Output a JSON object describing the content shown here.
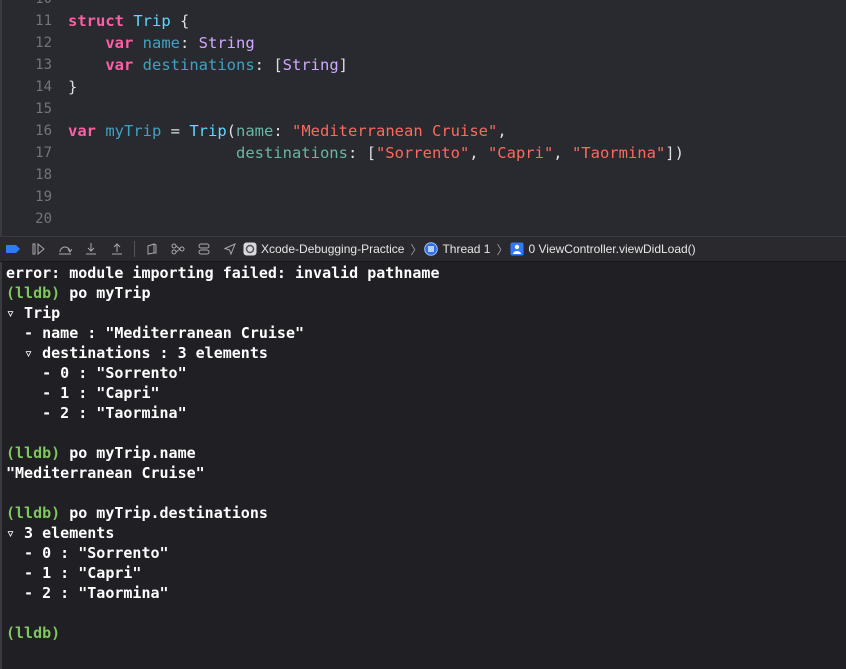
{
  "editor": {
    "lines": [
      {
        "num": "10",
        "tokens": []
      },
      {
        "num": "11",
        "tokens": [
          {
            "t": "struct",
            "c": "kw"
          },
          {
            "t": " ",
            "c": ""
          },
          {
            "t": "Trip",
            "c": "tn"
          },
          {
            "t": " {",
            "c": ""
          }
        ]
      },
      {
        "num": "12",
        "tokens": [
          {
            "t": "    ",
            "c": ""
          },
          {
            "t": "var",
            "c": "kw"
          },
          {
            "t": " ",
            "c": ""
          },
          {
            "t": "name",
            "c": "nm"
          },
          {
            "t": ": ",
            "c": ""
          },
          {
            "t": "String",
            "c": "ty"
          }
        ]
      },
      {
        "num": "13",
        "tokens": [
          {
            "t": "    ",
            "c": ""
          },
          {
            "t": "var",
            "c": "kw"
          },
          {
            "t": " ",
            "c": ""
          },
          {
            "t": "destinations",
            "c": "nm"
          },
          {
            "t": ": [",
            "c": ""
          },
          {
            "t": "String",
            "c": "ty"
          },
          {
            "t": "]",
            "c": ""
          }
        ]
      },
      {
        "num": "14",
        "tokens": [
          {
            "t": "}",
            "c": ""
          }
        ]
      },
      {
        "num": "15",
        "tokens": []
      },
      {
        "num": "16",
        "tokens": [
          {
            "t": "var",
            "c": "kw"
          },
          {
            "t": " ",
            "c": ""
          },
          {
            "t": "myTrip",
            "c": "nm"
          },
          {
            "t": " = ",
            "c": ""
          },
          {
            "t": "Trip",
            "c": "tn"
          },
          {
            "t": "(",
            "c": ""
          },
          {
            "t": "name",
            "c": "prm"
          },
          {
            "t": ": ",
            "c": ""
          },
          {
            "t": "\"Mediterranean Cruise\"",
            "c": "st"
          },
          {
            "t": ",",
            "c": ""
          }
        ]
      },
      {
        "num": "17",
        "tokens": [
          {
            "t": "                  ",
            "c": ""
          },
          {
            "t": "destinations",
            "c": "prm"
          },
          {
            "t": ": [",
            "c": ""
          },
          {
            "t": "\"Sorrento\"",
            "c": "st"
          },
          {
            "t": ", ",
            "c": ""
          },
          {
            "t": "\"Capri\"",
            "c": "st"
          },
          {
            "t": ", ",
            "c": ""
          },
          {
            "t": "\"Taormina\"",
            "c": "st"
          },
          {
            "t": "])",
            "c": ""
          }
        ]
      },
      {
        "num": "18",
        "tokens": []
      },
      {
        "num": "19",
        "tokens": []
      },
      {
        "num": "20",
        "tokens": []
      }
    ]
  },
  "toolbar": {
    "breadcrumb": {
      "project": "Xcode-Debugging-Practice",
      "thread": "Thread 1",
      "frame": "0 ViewController.viewDidLoad()"
    }
  },
  "console": {
    "lines": [
      {
        "prompt": "",
        "text": "error: module importing failed: invalid pathname"
      },
      {
        "prompt": "(lldb)",
        "text": " po myTrip"
      },
      {
        "prompt": "",
        "text": "▿ Trip"
      },
      {
        "prompt": "",
        "text": "  - name : \"Mediterranean Cruise\""
      },
      {
        "prompt": "",
        "text": "  ▿ destinations : 3 elements"
      },
      {
        "prompt": "",
        "text": "    - 0 : \"Sorrento\""
      },
      {
        "prompt": "",
        "text": "    - 1 : \"Capri\""
      },
      {
        "prompt": "",
        "text": "    - 2 : \"Taormina\""
      },
      {
        "prompt": "",
        "text": ""
      },
      {
        "prompt": "(lldb)",
        "text": " po myTrip.name"
      },
      {
        "prompt": "",
        "text": "\"Mediterranean Cruise\""
      },
      {
        "prompt": "",
        "text": ""
      },
      {
        "prompt": "(lldb)",
        "text": " po myTrip.destinations"
      },
      {
        "prompt": "",
        "text": "▿ 3 elements"
      },
      {
        "prompt": "",
        "text": "  - 0 : \"Sorrento\""
      },
      {
        "prompt": "",
        "text": "  - 1 : \"Capri\""
      },
      {
        "prompt": "",
        "text": "  - 2 : \"Taormina\""
      },
      {
        "prompt": "",
        "text": ""
      },
      {
        "prompt": "(lldb)",
        "text": ""
      }
    ]
  }
}
